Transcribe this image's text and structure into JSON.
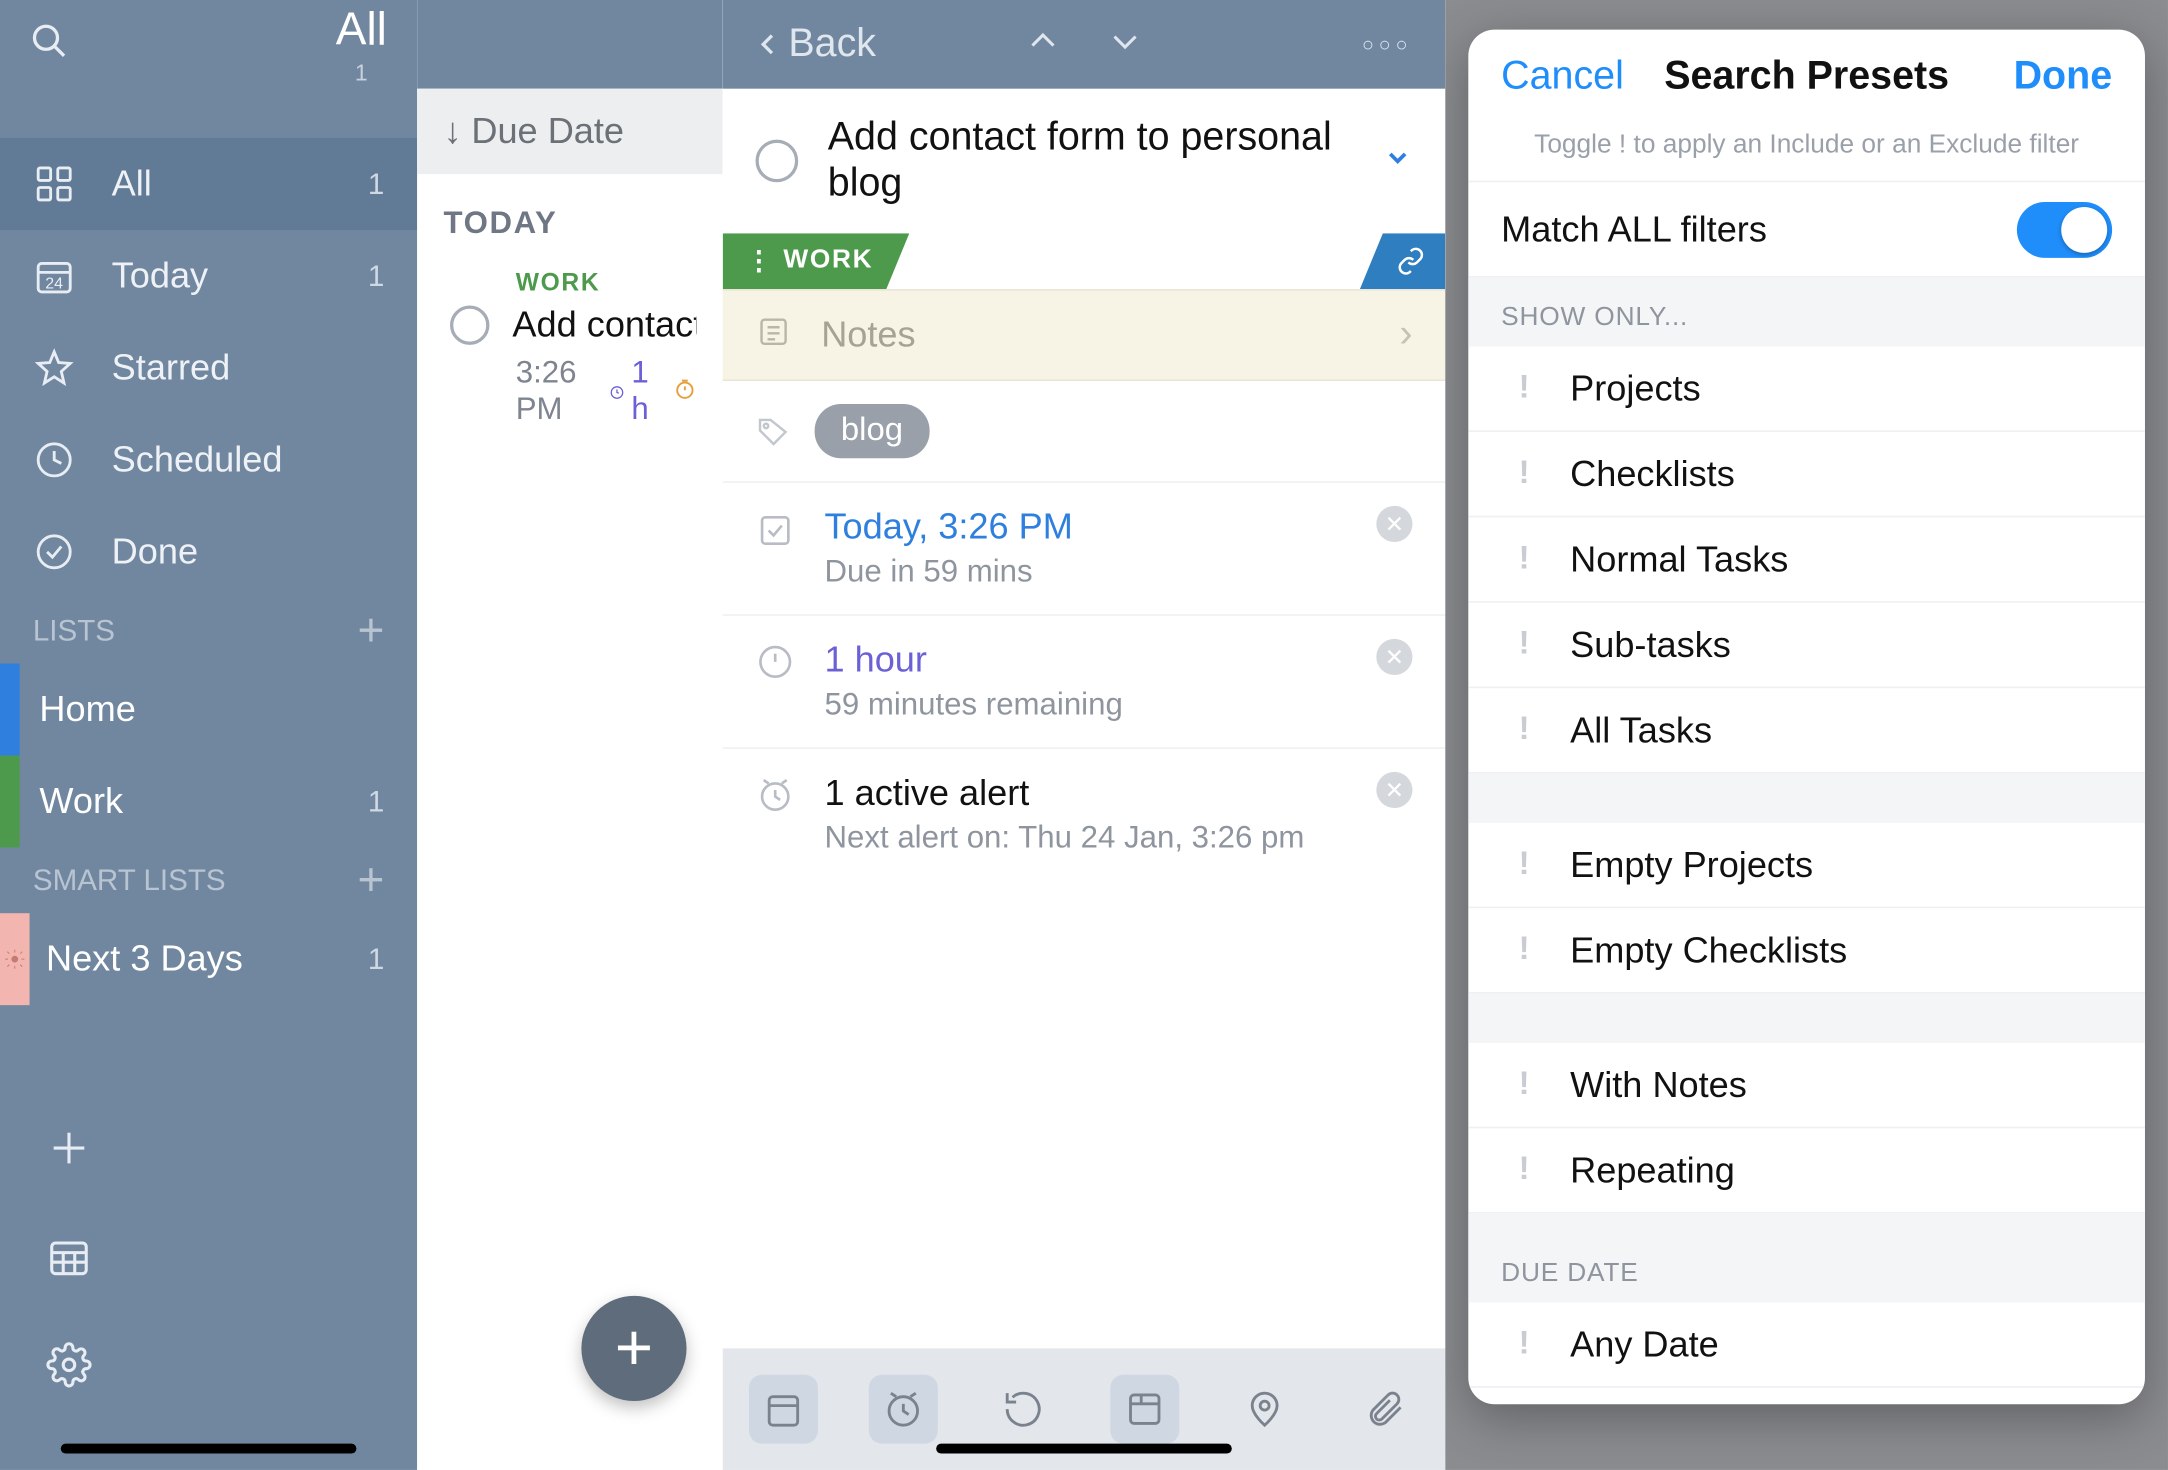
{
  "sidebar": {
    "title": "All",
    "title_count": "1",
    "items": [
      {
        "icon": "grid-icon",
        "label": "All",
        "count": "1"
      },
      {
        "icon": "calendar-icon",
        "label": "Today",
        "count": "1"
      },
      {
        "icon": "star-icon",
        "label": "Starred",
        "count": ""
      },
      {
        "icon": "clock-icon",
        "label": "Scheduled",
        "count": ""
      },
      {
        "icon": "check-icon",
        "label": "Done",
        "count": ""
      }
    ],
    "lists_header": "LISTS",
    "user_lists": [
      {
        "color": "#2f7fde",
        "label": "Home",
        "count": ""
      },
      {
        "color": "#4e9a4d",
        "label": "Work",
        "count": "1"
      }
    ],
    "smart_header": "SMART LISTS",
    "smart_lists": [
      {
        "label": "Next 3 Days",
        "count": "1"
      }
    ]
  },
  "tasklist": {
    "sort_label": "Due Date",
    "section": "TODAY",
    "task_list_tag": "WORK",
    "task_title": "Add contact form",
    "task_time": "3:26 PM",
    "task_duration": "1 h"
  },
  "detail": {
    "back": "Back",
    "title": "Add contact form to personal blog",
    "list_flag": "WORK",
    "notes_placeholder": "Notes",
    "tag": "blog",
    "due_main": "Today, 3:26 PM",
    "due_sub": "Due in 59 mins",
    "dur_main": "1 hour",
    "dur_sub": "59 minutes remaining",
    "alert_main": "1 active alert",
    "alert_sub": "Next alert on: Thu 24 Jan, 3:26 pm"
  },
  "presets": {
    "cancel": "Cancel",
    "title": "Search Presets",
    "done": "Done",
    "hint": "Toggle ! to apply an Include or an Exclude filter",
    "match": "Match ALL filters",
    "section_show": "SHOW ONLY...",
    "show_items": [
      "Projects",
      "Checklists",
      "Normal Tasks",
      "Sub-tasks",
      "All Tasks"
    ],
    "empty_items": [
      "Empty Projects",
      "Empty Checklists"
    ],
    "with_items": [
      "With Notes",
      "Repeating"
    ],
    "section_due": "DUE DATE",
    "due_items": [
      "Any Date"
    ]
  }
}
